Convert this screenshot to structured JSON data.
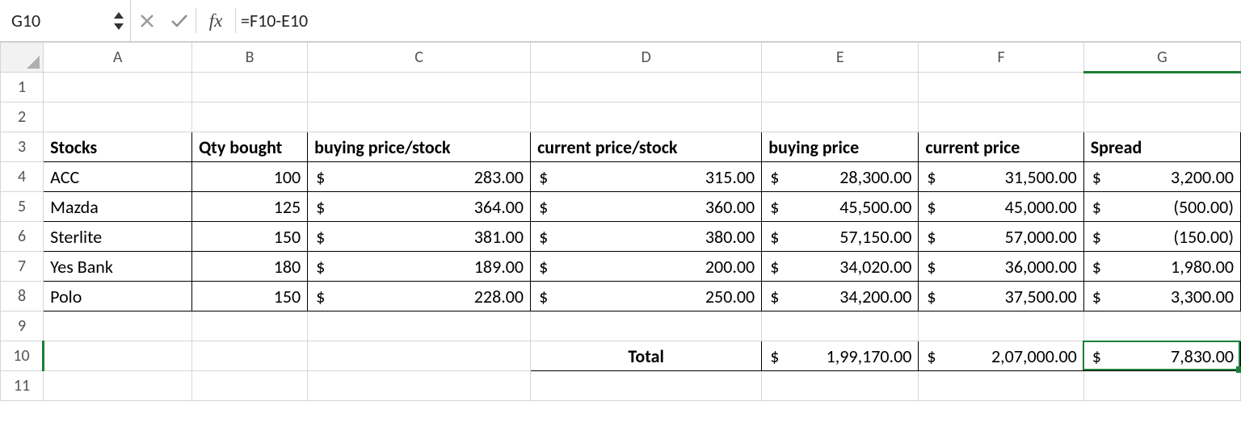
{
  "formula_bar": {
    "cell_ref": "G10",
    "fx_label": "fx",
    "formula": "=F10-E10"
  },
  "columns": [
    "A",
    "B",
    "C",
    "D",
    "E",
    "F",
    "G"
  ],
  "row_labels": [
    "1",
    "2",
    "3",
    "4",
    "5",
    "6",
    "7",
    "8",
    "9",
    "10",
    "11"
  ],
  "active": {
    "col": "G",
    "row": "10"
  },
  "headers": {
    "A": "Stocks",
    "B": "Qty bought",
    "C": "buying price/stock",
    "D": "current price/stock",
    "E": "buying price",
    "F": "current price",
    "G": "Spread"
  },
  "currency": "$",
  "rows": [
    {
      "A": "ACC",
      "B": "100",
      "C": "283.00",
      "D": "315.00",
      "E": "28,300.00",
      "F": "31,500.00",
      "G": "3,200.00"
    },
    {
      "A": "Mazda",
      "B": "125",
      "C": "364.00",
      "D": "360.00",
      "E": "45,500.00",
      "F": "45,000.00",
      "G": "(500.00)"
    },
    {
      "A": "Sterlite",
      "B": "150",
      "C": "381.00",
      "D": "380.00",
      "E": "57,150.00",
      "F": "57,000.00",
      "G": "(150.00)"
    },
    {
      "A": "Yes Bank",
      "B": "180",
      "C": "189.00",
      "D": "200.00",
      "E": "34,020.00",
      "F": "36,000.00",
      "G": "1,980.00"
    },
    {
      "A": "Polo",
      "B": "150",
      "C": "228.00",
      "D": "250.00",
      "E": "34,200.00",
      "F": "37,500.00",
      "G": "3,300.00"
    }
  ],
  "totals": {
    "label": "Total",
    "E": "1,99,170.00",
    "F": "2,07,000.00",
    "G": "7,830.00"
  }
}
